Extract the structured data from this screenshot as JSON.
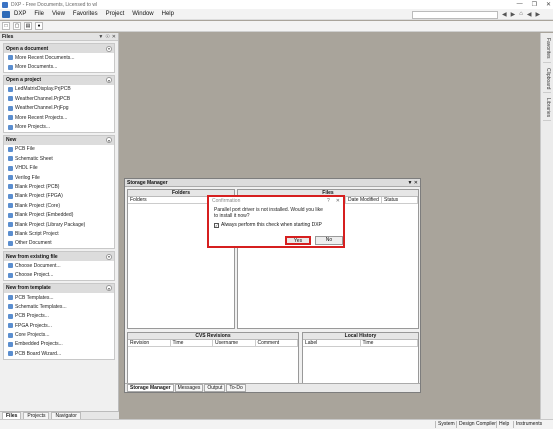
{
  "window": {
    "title": "DXP - Free Documents, Licensed to wl"
  },
  "menu": {
    "items": [
      "DXP",
      "File",
      "View",
      "Favorites",
      "Project",
      "Window",
      "Help"
    ]
  },
  "files_panel": {
    "title": "Files",
    "sections": [
      {
        "title": "Open a document",
        "items": [
          "More Recent Documents...",
          "More Documents..."
        ]
      },
      {
        "title": "Open a project",
        "items": [
          "LedMatrixDisplay.PrjPCB",
          "WeatherChannel.PrjPCB",
          "WeatherChannel.PrjFpg",
          "More Recent Projects...",
          "More Projects..."
        ]
      },
      {
        "title": "New",
        "items": [
          "PCB File",
          "Schematic Sheet",
          "VHDL File",
          "Verilog File",
          "Blank Project (PCB)",
          "Blank Project (FPGA)",
          "Blank Project (Core)",
          "Blank Project (Embedded)",
          "Blank Project (Library Package)",
          "Blank Script Project",
          "Other Document"
        ]
      },
      {
        "title": "New from existing file",
        "items": [
          "Choose Document...",
          "Choose Project..."
        ]
      },
      {
        "title": "New from template",
        "items": [
          "PCB Templates...",
          "Schematic Templates...",
          "PCB Projects...",
          "FPGA Projects...",
          "Core Projects...",
          "Embedded Projects...",
          "PCB Board Wizard..."
        ]
      }
    ],
    "tabs": [
      "Files",
      "Projects",
      "Navigator"
    ]
  },
  "right_strip": {
    "tabs": [
      "Favorites",
      "Clipboard",
      "Libraries"
    ]
  },
  "storage_manager": {
    "title": "Storage Manager",
    "folders_head": "Folders",
    "folders_col": "Folders",
    "files_head": "Files",
    "files_cols": [
      "Date Modified",
      "Status"
    ],
    "cvs_head": "CVS Revisions",
    "cvs_cols": [
      "Revision",
      "Time",
      "Username",
      "Comment"
    ],
    "history_head": "Local History",
    "history_cols": [
      "Label",
      "Time"
    ],
    "tabs": [
      "Storage Manager",
      "Messages",
      "Output",
      "To-Do"
    ]
  },
  "dialog": {
    "title": "Confirmation",
    "help": "?",
    "close": "✕",
    "message_line1": "Parallel port driver is not installed. Would you like",
    "message_line2": "to install it now?",
    "checkbox_label": "Always perform this check when starting DXP",
    "checkbox_checked": true,
    "yes": "Yes",
    "no": "No"
  },
  "statusbar": {
    "items": [
      "System",
      "Design Compiler",
      "Help",
      "Instruments"
    ]
  }
}
